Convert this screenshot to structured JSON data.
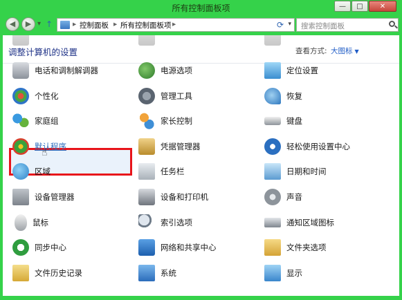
{
  "window": {
    "title": "所有控制面板项",
    "minimize": "—",
    "maximize": "□",
    "close": "✕"
  },
  "nav": {
    "back_glyph": "◀",
    "forward_glyph": "▶",
    "down_glyph": "▾",
    "up_glyph": "↑",
    "breadcrumb": [
      "控制面板",
      "所有控制面板项"
    ],
    "crumb_sep": "▸",
    "address_dropdown": "▾",
    "refresh_glyph": "⟳",
    "search_placeholder": "搜索控制面板"
  },
  "header": {
    "title": "调整计算机的设置",
    "view_label": "查看方式:",
    "view_value": "大图标",
    "view_caret": "▼"
  },
  "items": {
    "c1": [
      "",
      "电话和调制解调器",
      "个性化",
      "家庭组",
      "默认程序",
      "区域",
      "设备管理器",
      "鼠标",
      "同步中心",
      "文件历史记录"
    ],
    "c2": [
      "",
      "电源选项",
      "管理工具",
      "家长控制",
      "凭据管理器",
      "任务栏",
      "设备和打印机",
      "索引选项",
      "网络和共享中心",
      "系统"
    ],
    "c3": [
      "",
      "定位设置",
      "恢复",
      "键盘",
      "轻松使用设置中心",
      "日期和时间",
      "声音",
      "通知区域图标",
      "文件夹选项",
      "显示"
    ]
  },
  "icons": {
    "c1": [
      "partial-icon",
      "phone-modem-icon",
      "personalization-icon",
      "homegroup-icon",
      "default-programs-icon",
      "region-icon",
      "device-manager-icon",
      "mouse-icon",
      "sync-center-icon",
      "file-history-icon"
    ],
    "c2": [
      "partial-icon",
      "power-options-icon",
      "admin-tools-icon",
      "parental-controls-icon",
      "credential-manager-icon",
      "taskbar-icon",
      "devices-printers-icon",
      "indexing-options-icon",
      "network-sharing-icon",
      "system-icon"
    ],
    "c3": [
      "partial-icon",
      "location-settings-icon",
      "recovery-icon",
      "keyboard-icon",
      "ease-of-access-icon",
      "date-time-icon",
      "sound-icon",
      "notification-icons-icon",
      "folder-options-icon",
      "display-icon"
    ]
  },
  "highlighted_item": "默认程序",
  "colors": {
    "frame": "#35d24a",
    "highlight_border": "#e8141a",
    "link": "#2f6fc0",
    "header_title": "#1e3287"
  }
}
